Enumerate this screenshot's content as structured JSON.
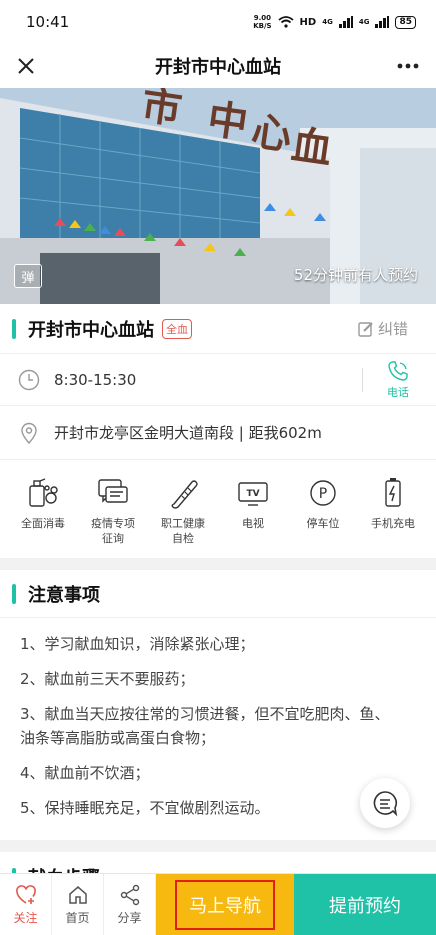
{
  "status_bar": {
    "time": "10:41",
    "net_speed": "9.00",
    "net_unit": "KB/S",
    "network": "HD",
    "sig1": "4G",
    "sig2": "4G",
    "battery": "85"
  },
  "nav": {
    "title": "开封市中心血站"
  },
  "hero": {
    "danmu_label": "弹",
    "booking_note": "52分钟前有人预约"
  },
  "station": {
    "name": "开封市中心血站",
    "badge": "全血",
    "correction": "纠错",
    "hours": "8:30-15:30",
    "phone_label": "电话",
    "address": "开封市龙亭区金明大道南段 | 距我602m"
  },
  "amenities": [
    {
      "label": "全面消毒",
      "icon": "disinfect-icon"
    },
    {
      "label": "疫情专项\n征询",
      "icon": "consult-icon"
    },
    {
      "label": "职工健康\n自检",
      "icon": "thermometer-icon"
    },
    {
      "label": "电视",
      "icon": "tv-icon"
    },
    {
      "label": "停车位",
      "icon": "parking-icon"
    },
    {
      "label": "手机充电",
      "icon": "battery-charge-icon"
    }
  ],
  "notes": {
    "title": "注意事项",
    "items": [
      "1、学习献血知识，消除紧张心理；",
      "2、献血前三天不要服药；",
      "3、献血当天应按往常的习惯进餐，但不宜吃肥肉、鱼、油条等高脂肪或高蛋白食物；",
      "4、献血前不饮酒；",
      "5、保持睡眠充足，不宜做剧烈运动。"
    ]
  },
  "next_section": {
    "title": "献血步骤"
  },
  "bottom": {
    "follow": "关注",
    "home": "首页",
    "share": "分享",
    "navigate": "马上导航",
    "book": "提前预约"
  },
  "colors": {
    "accent": "#1fc2a7",
    "navigate_bg": "#f7b90f",
    "badge_red": "#e3584f"
  }
}
